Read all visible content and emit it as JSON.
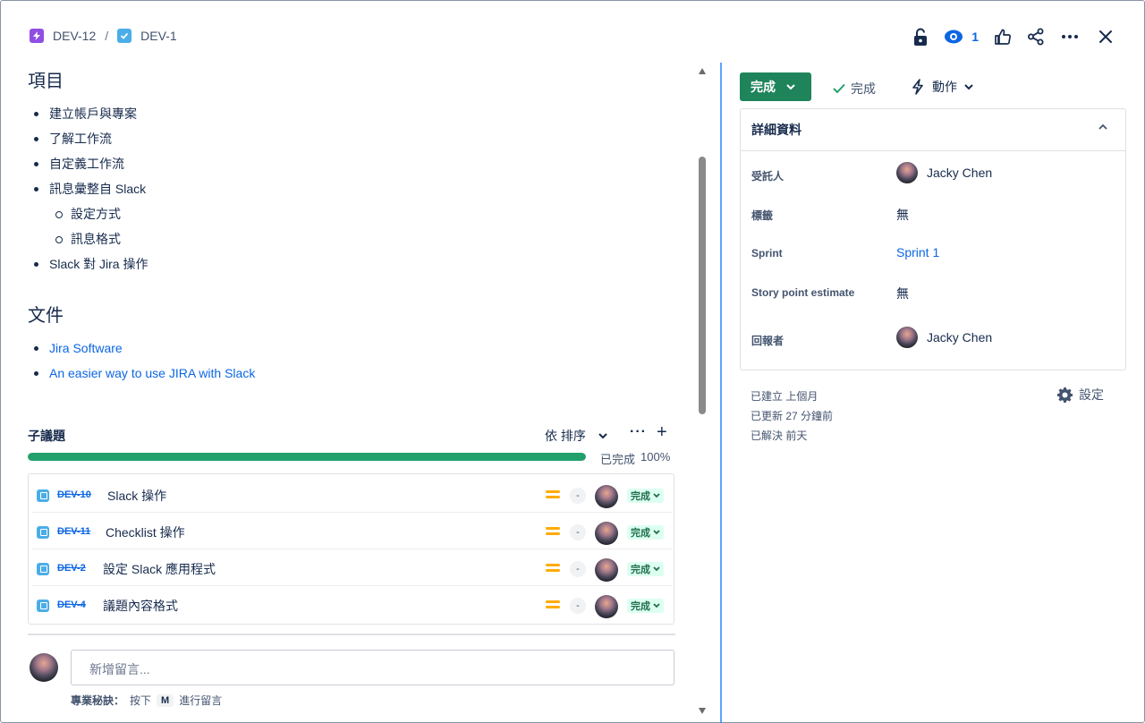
{
  "breadcrumb": {
    "parent_key": "DEV-12",
    "separator": "/",
    "current_key": "DEV-1"
  },
  "top_actions": {
    "watch_count": "1",
    "icons": [
      "lock-open-icon",
      "eye-icon",
      "thumbs-up-icon",
      "share-icon",
      "more-icon",
      "close-icon"
    ]
  },
  "description": {
    "items_heading": "項目",
    "items": [
      {
        "text": "建立帳戶與專案",
        "level": 1
      },
      {
        "text": "了解工作流",
        "level": 1
      },
      {
        "text": "自定義工作流",
        "level": 1
      },
      {
        "text": "訊息彙整自 Slack",
        "level": 1
      },
      {
        "text": "設定方式",
        "level": 2
      },
      {
        "text": "訊息格式",
        "level": 2
      },
      {
        "text": "Slack 對 Jira 操作",
        "level": 1
      }
    ],
    "docs_heading": "文件",
    "docs": [
      {
        "text": "Jira Software"
      },
      {
        "text": "An easier way to use JIRA with Slack"
      }
    ]
  },
  "subtasks": {
    "title": "子議題",
    "sort_label": "依 排序",
    "more_label": "···",
    "add_label": "+",
    "progress_label": "已完成",
    "progress_percent_text": "100%",
    "progress_fraction": 1.0,
    "rows": [
      {
        "key": "DEV-10",
        "summary": "Slack 操作",
        "estimate": "-",
        "status": "完成"
      },
      {
        "key": "DEV-11",
        "summary": "Checklist 操作",
        "estimate": "-",
        "status": "完成"
      },
      {
        "key": "DEV-2",
        "summary": "設定 Slack 應用程式",
        "estimate": "-",
        "status": "完成"
      },
      {
        "key": "DEV-4",
        "summary": "議題內容格式",
        "estimate": "-",
        "status": "完成"
      }
    ]
  },
  "comment": {
    "placeholder": "新增留言...",
    "tip_label": "專業秘訣：",
    "tip_press": "按下",
    "tip_key": "M",
    "tip_action": "進行留言"
  },
  "right": {
    "status_button": "完成",
    "resolution": "完成",
    "actions_label": "動作",
    "details_title": "詳細資料",
    "fields": {
      "assignee_label": "受託人",
      "assignee_value": "Jacky Chen",
      "labels_label": "標籤",
      "labels_value": "無",
      "sprint_label": "Sprint",
      "sprint_value": "Sprint 1",
      "estimate_label": "Story point estimate",
      "estimate_value": "無",
      "reporter_label": "回報者",
      "reporter_value": "Jacky Chen"
    },
    "created": "已建立 上個月",
    "updated": "已更新 27 分鐘前",
    "resolved": "已解決 前天",
    "settings_label": "設定"
  },
  "colors": {
    "link": "#0c66e4",
    "done_green": "#1f845a",
    "progress_green": "#22a06b",
    "priority_medium": "#ffab00",
    "epic_purple": "#904ee2",
    "task_blue": "#4bade8"
  }
}
